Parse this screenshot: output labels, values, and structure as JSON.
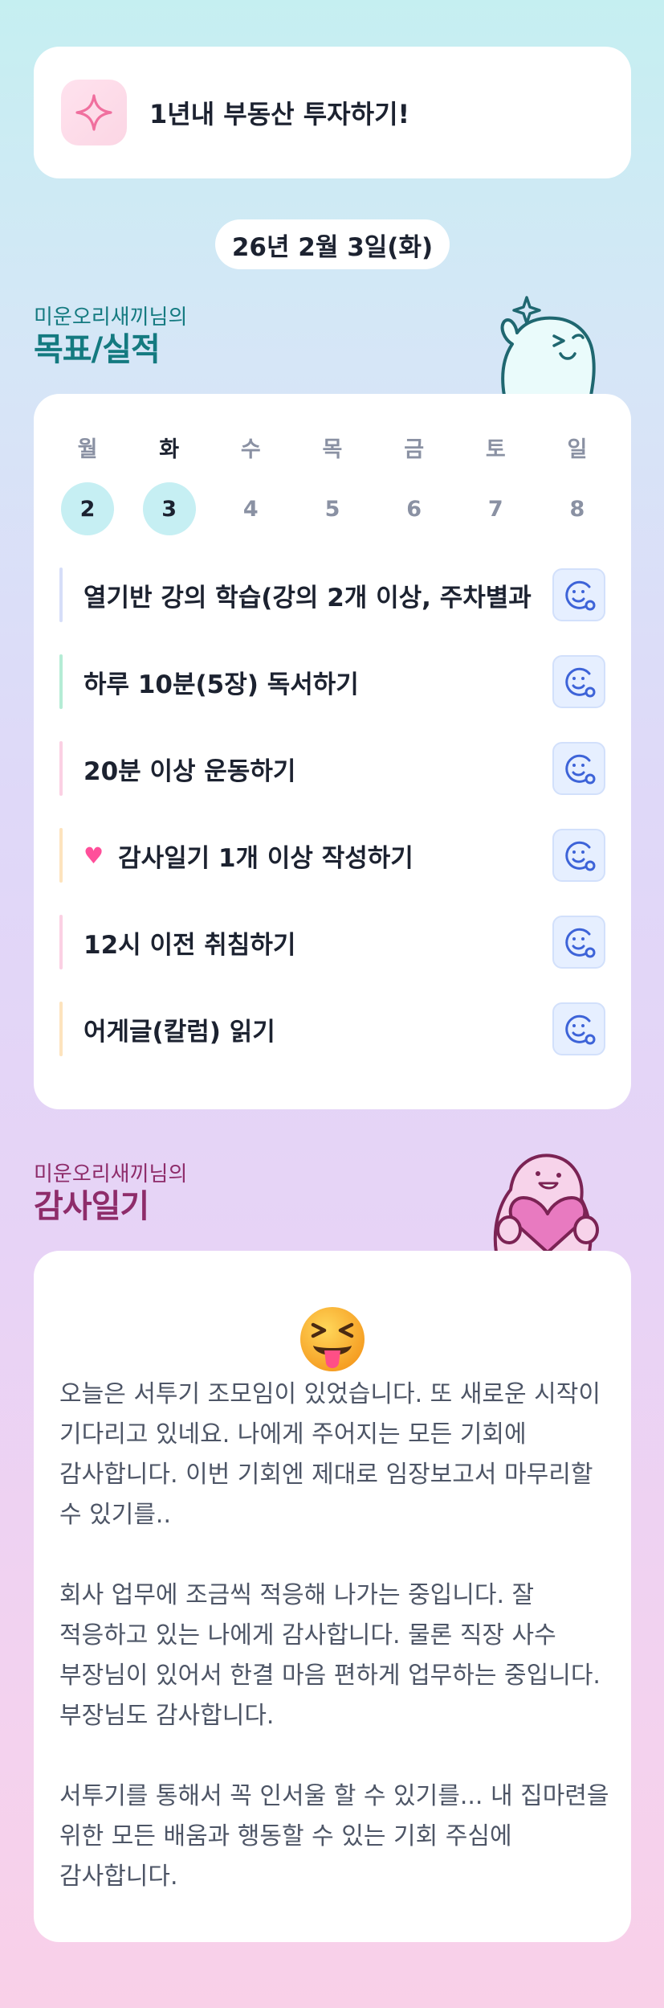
{
  "goal_header": {
    "title": "1년내 부동산 투자하기!",
    "icon": "sparkle-icon"
  },
  "date": "26년 2월 3일(화)",
  "goals_section": {
    "user": "미운오리새끼님의",
    "title": "목표/실적"
  },
  "week": {
    "days": [
      {
        "name": "월",
        "date": "2",
        "selected": true
      },
      {
        "name": "화",
        "date": "3",
        "selected": true,
        "today": true
      },
      {
        "name": "수",
        "date": "4",
        "selected": false
      },
      {
        "name": "목",
        "date": "5",
        "selected": false
      },
      {
        "name": "금",
        "date": "6",
        "selected": false
      },
      {
        "name": "토",
        "date": "7",
        "selected": false
      },
      {
        "name": "일",
        "date": "8",
        "selected": false
      }
    ]
  },
  "goals": [
    {
      "text": "열기반 강의 학습(강의 2개 이상, 주차별과",
      "color": "#d6def8",
      "icon": "smiley-icon"
    },
    {
      "text": "하루 10분(5장) 독서하기",
      "color": "#b5ecd5",
      "icon": "smiley-icon"
    },
    {
      "text": "20분 이상 운동하기",
      "color": "#fbd0e3",
      "icon": "smiley-icon"
    },
    {
      "text": "감사일기 1개 이상 작성하기",
      "color": "#fde3bd",
      "icon": "smiley-icon",
      "prefix_icon": "heart-icon"
    },
    {
      "text": "12시 이전 취침하기",
      "color": "#fbd0e3",
      "icon": "smiley-icon"
    },
    {
      "text": "어게글(칼럼) 읽기",
      "color": "#fde3bd",
      "icon": "smiley-icon"
    }
  ],
  "gratitude_section": {
    "user": "미운오리새끼님의",
    "title": "감사일기"
  },
  "gratitude": {
    "emoji": "squinting-tongue-face",
    "paragraphs": [
      "오늘은 서투기 조모임이 있었습니다. 또 새로운 시작이 기다리고 있네요. 나에게 주어지는 모든 기회에 감사합니다. 이번 기회엔 제대로 임장보고서 마무리할 수 있기를..",
      "회사 업무에 조금씩 적응해 나가는 중입니다. 잘 적응하고 있는 나에게 감사합니다. 물론 직장 사수 부장님이 있어서 한결 마음 편하게 업무하는 중입니다. 부장님도 감사합니다.",
      "서투기를 통해서 꼭 인서울 할 수 있기를... 내 집마련을 위한 모든 배움과 행동할 수 있는 기회 주심에 감사합니다."
    ]
  },
  "colors": {
    "goals_title": "#147a80",
    "gratitude_title": "#8e2c6a",
    "selected_day": "#c6eff3",
    "face_icon": "#3d63d8"
  }
}
